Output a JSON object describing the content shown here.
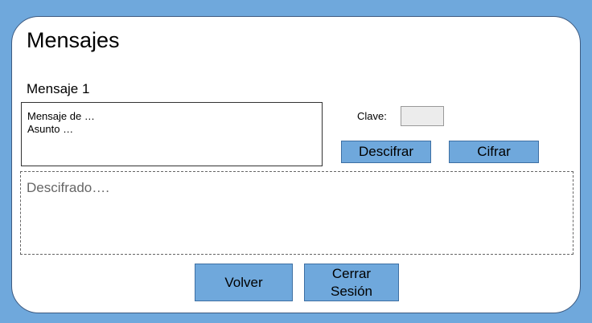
{
  "page": {
    "title": "Mensajes",
    "message_heading": "Mensaje 1"
  },
  "message": {
    "from_line": "Mensaje de …",
    "subject_line": "Asunto …"
  },
  "key": {
    "label": "Clave:",
    "value": ""
  },
  "buttons": {
    "decrypt": "Descifrar",
    "encrypt": "Cifrar",
    "back": "Volver",
    "logout_line1": "Cerrar",
    "logout_line2": "Sesión"
  },
  "output": {
    "placeholder": "Descifrado…."
  },
  "colors": {
    "background": "#6fa8dc",
    "button": "#6fa8dc",
    "panel": "#ffffff",
    "key_input": "#ececec"
  }
}
